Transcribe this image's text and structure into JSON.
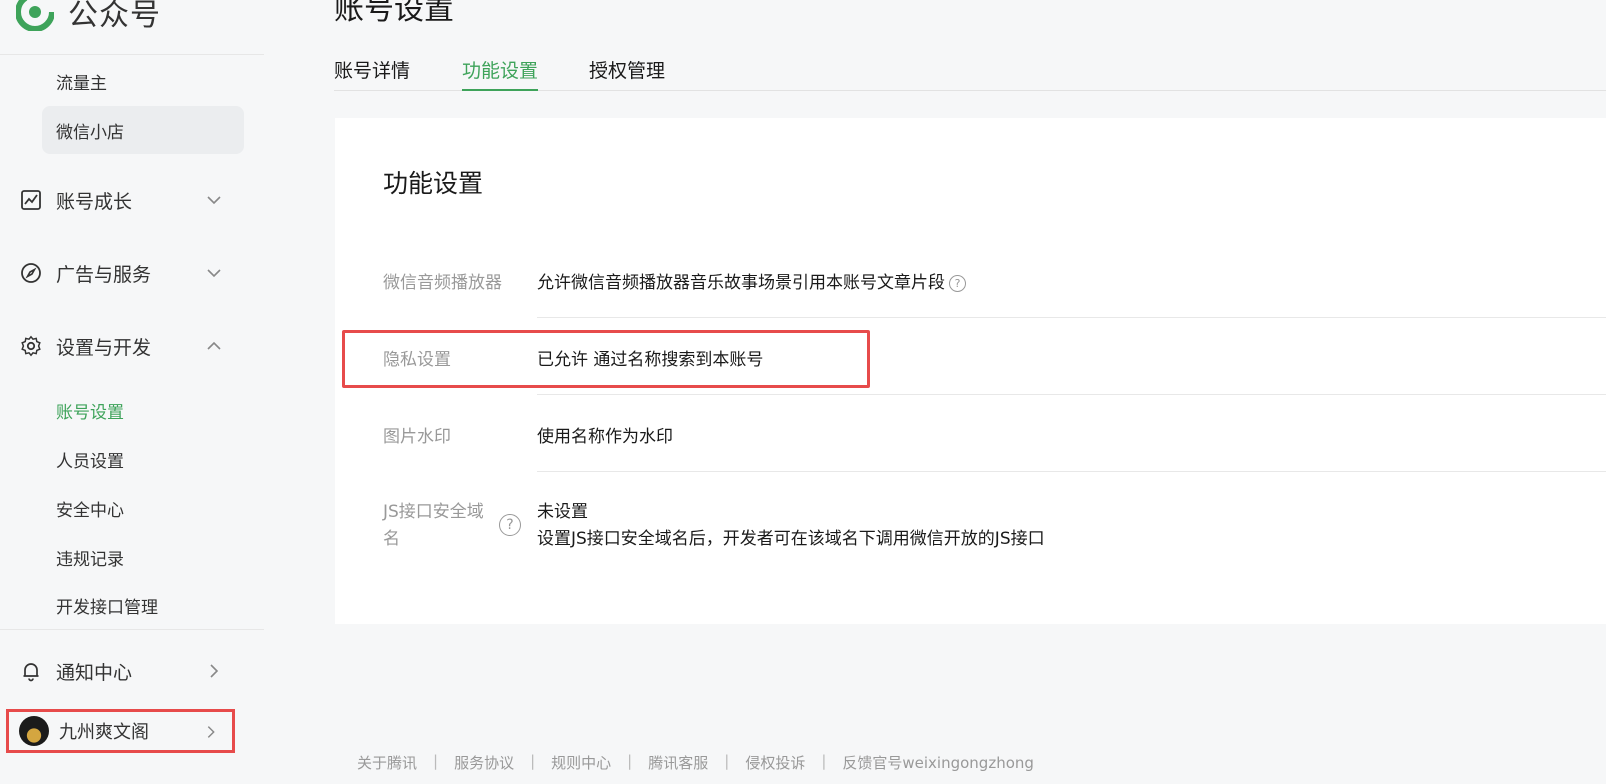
{
  "brand": {
    "name": "公众号",
    "logo_color": "#3ea35a"
  },
  "sidebar": {
    "sub_items_top": [
      {
        "label": "流量主"
      },
      {
        "label": "微信小店"
      }
    ],
    "groups": [
      {
        "label": "账号成长",
        "icon": "trend-chart-icon",
        "expanded": false
      },
      {
        "label": "广告与服务",
        "icon": "compass-icon",
        "expanded": false
      },
      {
        "label": "设置与开发",
        "icon": "gear-icon",
        "expanded": true
      }
    ],
    "settings_items": [
      {
        "label": "账号设置",
        "active": true
      },
      {
        "label": "人员设置"
      },
      {
        "label": "安全中心"
      },
      {
        "label": "违规记录"
      },
      {
        "label": "开发接口管理"
      }
    ],
    "notification": {
      "label": "通知中心",
      "icon": "bell-icon"
    },
    "account": {
      "name": "九州爽文阁"
    }
  },
  "main": {
    "page_title": "账号设置",
    "tabs": [
      {
        "label": "账号详情"
      },
      {
        "label": "功能设置",
        "active": true
      },
      {
        "label": "授权管理"
      }
    ],
    "card": {
      "title": "功能设置",
      "rows": [
        {
          "label": "微信音频播放器",
          "value": "允许微信音频播放器音乐故事场景引用本账号文章片段",
          "help": "?"
        },
        {
          "label": "隐私设置",
          "value": "已允许 通过名称搜索到本账号"
        },
        {
          "label": "图片水印",
          "value": "使用名称作为水印"
        },
        {
          "label_line1": "JS接口安全域",
          "label_line2": "名",
          "help": "?",
          "value": "未设置",
          "value2": "设置JS接口安全域名后，开发者可在该域名下调用微信开放的JS接口"
        }
      ]
    }
  },
  "footer": {
    "links": [
      "关于腾讯",
      "服务协议",
      "规则中心",
      "腾讯客服",
      "侵权投诉",
      "反馈官号weixingongzhong"
    ]
  },
  "colors": {
    "accent": "#3ea35a",
    "highlight": "#e74b4b"
  }
}
